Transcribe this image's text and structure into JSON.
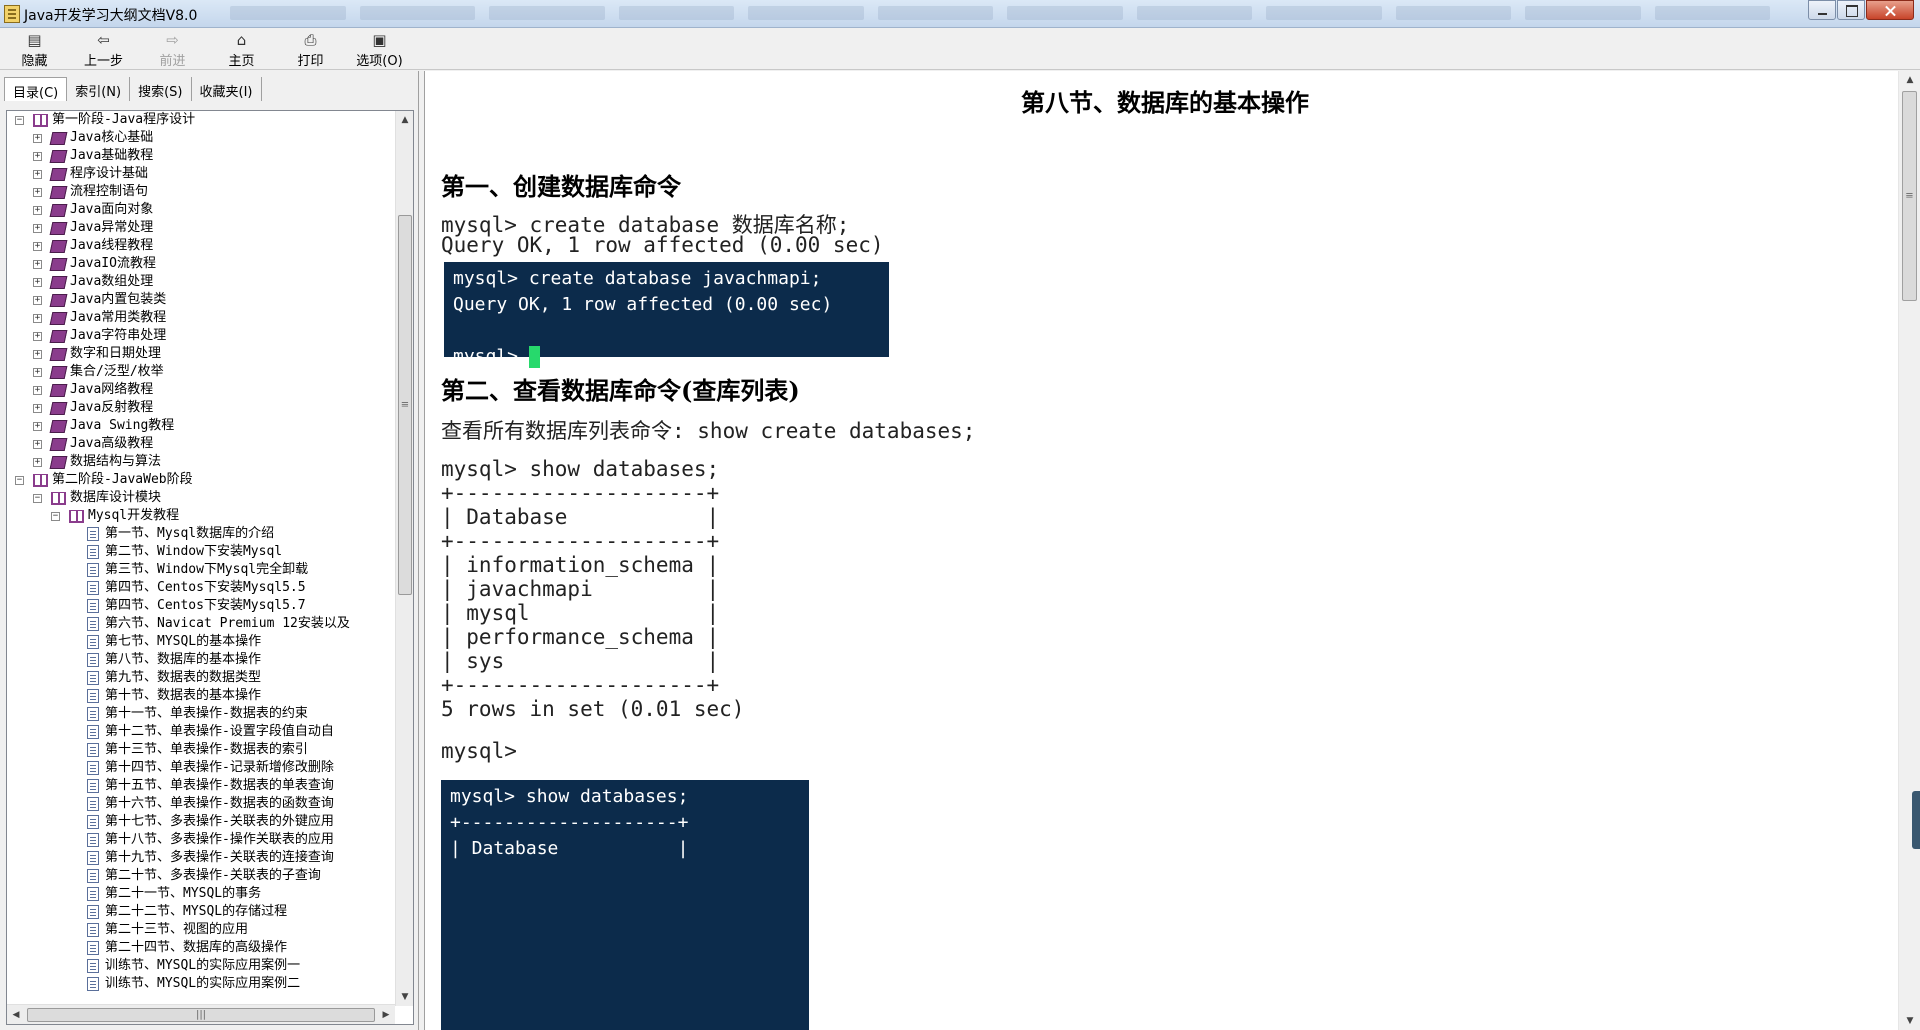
{
  "window": {
    "title": "Java开发学习大纲文档V8.0"
  },
  "toolbar": [
    {
      "label": "隐藏",
      "icon": "hide-icon",
      "glyph": "▤",
      "enabled": true
    },
    {
      "label": "上一步",
      "icon": "back-icon",
      "glyph": "⇦",
      "enabled": true
    },
    {
      "label": "前进",
      "icon": "forward-icon",
      "glyph": "⇨",
      "enabled": false
    },
    {
      "label": "主页",
      "icon": "home-icon",
      "glyph": "⌂",
      "enabled": true
    },
    {
      "label": "打印",
      "icon": "print-icon",
      "glyph": "⎙",
      "enabled": true
    },
    {
      "label": "选项(O)",
      "icon": "options-icon",
      "glyph": "▣",
      "enabled": true
    }
  ],
  "nav_tabs": [
    "目录(C)",
    "索引(N)",
    "搜索(S)",
    "收藏夹(I)"
  ],
  "tree": [
    {
      "level": 0,
      "type": "book-open",
      "expander": "−",
      "label": "第一阶段-Java程序设计"
    },
    {
      "level": 1,
      "type": "book",
      "expander": "+",
      "label": "Java核心基础"
    },
    {
      "level": 1,
      "type": "book",
      "expander": "+",
      "label": "Java基础教程"
    },
    {
      "level": 1,
      "type": "book",
      "expander": "+",
      "label": "程序设计基础"
    },
    {
      "level": 1,
      "type": "book",
      "expander": "+",
      "label": "流程控制语句"
    },
    {
      "level": 1,
      "type": "book",
      "expander": "+",
      "label": "Java面向对象"
    },
    {
      "level": 1,
      "type": "book",
      "expander": "+",
      "label": "Java异常处理"
    },
    {
      "level": 1,
      "type": "book",
      "expander": "+",
      "label": "Java线程教程"
    },
    {
      "level": 1,
      "type": "book",
      "expander": "+",
      "label": "JavaIO流教程"
    },
    {
      "level": 1,
      "type": "book",
      "expander": "+",
      "label": "Java数组处理"
    },
    {
      "level": 1,
      "type": "book",
      "expander": "+",
      "label": "Java内置包装类"
    },
    {
      "level": 1,
      "type": "book",
      "expander": "+",
      "label": "Java常用类教程"
    },
    {
      "level": 1,
      "type": "book",
      "expander": "+",
      "label": "Java字符串处理"
    },
    {
      "level": 1,
      "type": "book",
      "expander": "+",
      "label": "数字和日期处理"
    },
    {
      "level": 1,
      "type": "book",
      "expander": "+",
      "label": "集合/泛型/枚举"
    },
    {
      "level": 1,
      "type": "book",
      "expander": "+",
      "label": "Java网络教程"
    },
    {
      "level": 1,
      "type": "book",
      "expander": "+",
      "label": "Java反射教程"
    },
    {
      "level": 1,
      "type": "book",
      "expander": "+",
      "label": "Java Swing教程"
    },
    {
      "level": 1,
      "type": "book",
      "expander": "+",
      "label": "Java高级教程"
    },
    {
      "level": 1,
      "type": "book",
      "expander": "+",
      "label": "数据结构与算法"
    },
    {
      "level": 0,
      "type": "book-open",
      "expander": "−",
      "label": "第二阶段-JavaWeb阶段"
    },
    {
      "level": 1,
      "type": "book-open",
      "expander": "−",
      "label": "数据库设计模块"
    },
    {
      "level": 2,
      "type": "book-open",
      "expander": "−",
      "label": "Mysql开发教程"
    },
    {
      "level": 3,
      "type": "page",
      "expander": "",
      "label": "第一节、Mysql数据库的介绍"
    },
    {
      "level": 3,
      "type": "page",
      "expander": "",
      "label": "第二节、Window下安装Mysql"
    },
    {
      "level": 3,
      "type": "page",
      "expander": "",
      "label": "第三节、Window下Mysql完全卸载"
    },
    {
      "level": 3,
      "type": "page",
      "expander": "",
      "label": "第四节、Centos下安装Mysql5.5"
    },
    {
      "level": 3,
      "type": "page",
      "expander": "",
      "label": "第四节、Centos下安装Mysql5.7"
    },
    {
      "level": 3,
      "type": "page",
      "expander": "",
      "label": "第六节、Navicat Premium 12安装以及"
    },
    {
      "level": 3,
      "type": "page",
      "expander": "",
      "label": "第七节、MYSQL的基本操作"
    },
    {
      "level": 3,
      "type": "page",
      "expander": "",
      "label": "第八节、数据库的基本操作"
    },
    {
      "level": 3,
      "type": "page",
      "expander": "",
      "label": "第九节、数据表的数据类型"
    },
    {
      "level": 3,
      "type": "page",
      "expander": "",
      "label": "第十节、数据表的基本操作"
    },
    {
      "level": 3,
      "type": "page",
      "expander": "",
      "label": "第十一节、单表操作-数据表的约束"
    },
    {
      "level": 3,
      "type": "page",
      "expander": "",
      "label": "第十二节、单表操作-设置字段值自动自"
    },
    {
      "level": 3,
      "type": "page",
      "expander": "",
      "label": "第十三节、单表操作-数据表的索引"
    },
    {
      "level": 3,
      "type": "page",
      "expander": "",
      "label": "第十四节、单表操作-记录新增修改删除"
    },
    {
      "level": 3,
      "type": "page",
      "expander": "",
      "label": "第十五节、单表操作-数据表的单表查询"
    },
    {
      "level": 3,
      "type": "page",
      "expander": "",
      "label": "第十六节、单表操作-数据表的函数查询"
    },
    {
      "level": 3,
      "type": "page",
      "expander": "",
      "label": "第十七节、多表操作-关联表的外键应用"
    },
    {
      "level": 3,
      "type": "page",
      "expander": "",
      "label": "第十八节、多表操作-操作关联表的应用"
    },
    {
      "level": 3,
      "type": "page",
      "expander": "",
      "label": "第十九节、多表操作-关联表的连接查询"
    },
    {
      "level": 3,
      "type": "page",
      "expander": "",
      "label": "第二十节、多表操作-关联表的子查询"
    },
    {
      "level": 3,
      "type": "page",
      "expander": "",
      "label": "第二十一节、MYSQL的事务"
    },
    {
      "level": 3,
      "type": "page",
      "expander": "",
      "label": "第二十二节、MYSQL的存储过程"
    },
    {
      "level": 3,
      "type": "page",
      "expander": "",
      "label": "第二十三节、视图的应用"
    },
    {
      "level": 3,
      "type": "page",
      "expander": "",
      "label": "第二十四节、数据库的高级操作"
    },
    {
      "level": 3,
      "type": "page",
      "expander": "",
      "label": "训练节、MYSQL的实际应用案例一"
    },
    {
      "level": 3,
      "type": "page",
      "expander": "",
      "label": "训练节、MYSQL的实际应用案例二"
    }
  ],
  "content": {
    "title": "第八节、数据库的基本操作",
    "section1": {
      "heading": "第一、创建数据库命令",
      "lines": [
        "mysql> create database 数据库名称;",
        "Query OK, 1 row affected (0.00 sec)"
      ],
      "terminal": [
        "mysql> create database javachmapi;",
        "Query OK, 1 row affected (0.00 sec)",
        "",
        "mysql> "
      ]
    },
    "section2": {
      "heading": "第二、查看数据库命令(查库列表)",
      "intro": "查看所有数据库列表命令: show create databases;",
      "lines": [
        "mysql> show databases;",
        "+--------------------+",
        "| Database           |",
        "+--------------------+",
        "| information_schema |",
        "| javachmapi         |",
        "| mysql              |",
        "| performance_schema |",
        "| sys                |",
        "+--------------------+",
        "5 rows in set (0.01 sec)",
        "",
        "mysql>"
      ],
      "terminal": [
        "mysql> show databases;",
        "+--------------------+",
        "| Database           |"
      ]
    }
  },
  "colors": {
    "terminal_bg": "#0c2b4b",
    "cursor": "#27d96c",
    "book_icon": "#8a3c8c"
  }
}
